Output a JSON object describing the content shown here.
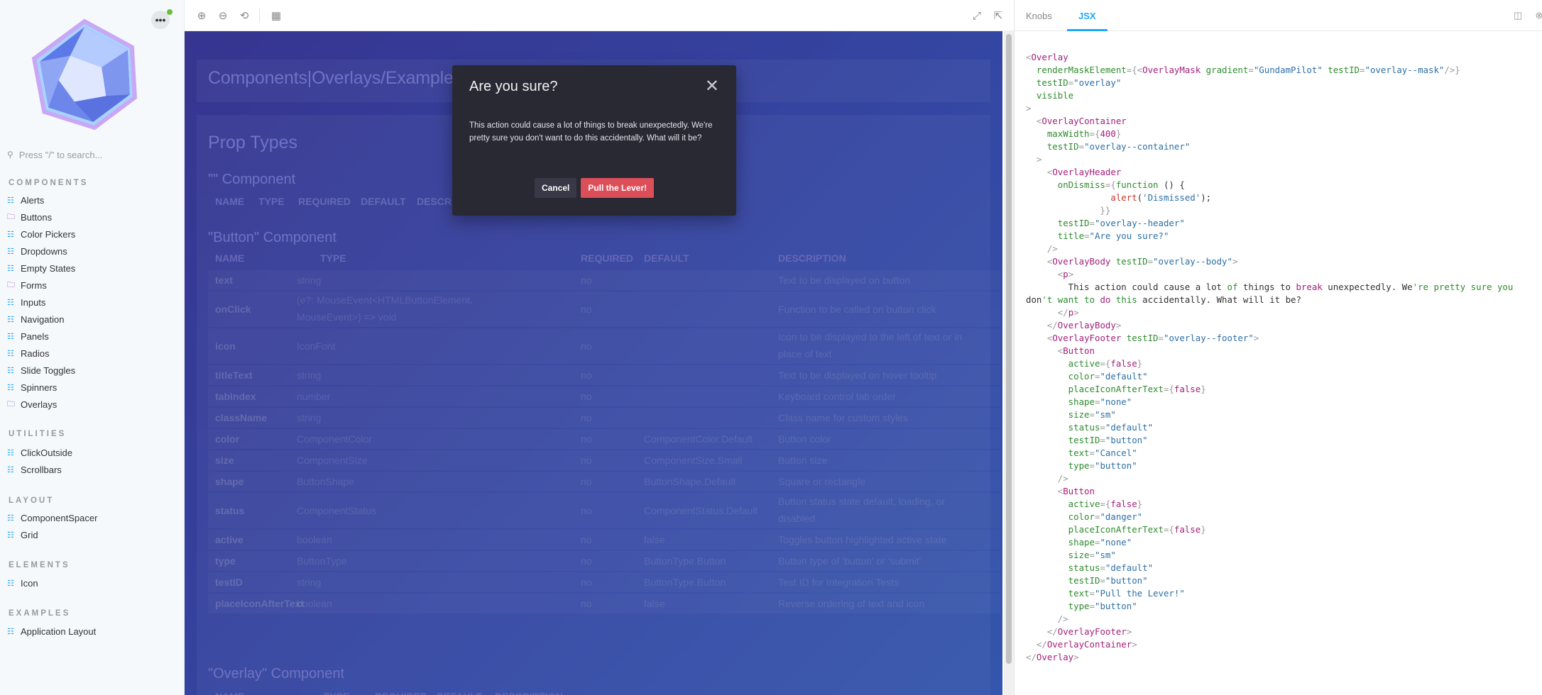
{
  "sidebar": {
    "search_placeholder": "Press \"/\" to search...",
    "sections": [
      {
        "heading": "COMPONENTS",
        "items": [
          "Alerts",
          "Buttons",
          "Color Pickers",
          "Dropdowns",
          "Empty States",
          "Forms",
          "Inputs",
          "Navigation",
          "Panels",
          "Radios",
          "Slide Toggles",
          "Spinners",
          "Overlays"
        ]
      },
      {
        "heading": "UTILITIES",
        "items": [
          "ClickOutside",
          "Scrollbars"
        ]
      },
      {
        "heading": "LAYOUT",
        "items": [
          "ComponentSpacer",
          "Grid"
        ]
      },
      {
        "heading": "ELEMENTS",
        "items": [
          "Icon"
        ]
      },
      {
        "heading": "EXAMPLES",
        "items": [
          "Application Layout"
        ]
      }
    ]
  },
  "preview": {
    "story_title": "Components|Overlays/Examples",
    "prop_types_heading": "Prop Types",
    "empty_component_title": "\"\" Component",
    "empty_component_headers": [
      "NAME",
      "TYPE",
      "REQUIRED",
      "DEFAULT",
      "DESCRI"
    ],
    "button_component_title": "\"Button\" Component",
    "headers": [
      "NAME",
      "TYPE",
      "REQUIRED",
      "DEFAULT",
      "DESCRIPTION"
    ],
    "rows": [
      {
        "name": "text",
        "type": "string",
        "required": "no",
        "default": "",
        "description": "Text to be displayed on button"
      },
      {
        "name": "onClick",
        "type": "(e?: MouseEvent<HTMLButtonElement,",
        "type2": "MouseEvent>) => void",
        "required": "no",
        "default": "",
        "description": "Function to be called on button click"
      },
      {
        "name": "icon",
        "type": "IconFont",
        "required": "no",
        "default": "",
        "description": "Icon to be displayed to the left of text or in",
        "description2": "place of text"
      },
      {
        "name": "titleText",
        "type": "string",
        "required": "no",
        "default": "",
        "description": "Text to be displayed on hover tooltip"
      },
      {
        "name": "tabIndex",
        "type": "number",
        "required": "no",
        "default": "",
        "description": "Keyboard control tab order"
      },
      {
        "name": "className",
        "type": "string",
        "required": "no",
        "default": "",
        "description": "Class name for custom styles"
      },
      {
        "name": "color",
        "type": "ComponentColor",
        "required": "no",
        "default": "ComponentColor.Default",
        "description": "Button color"
      },
      {
        "name": "size",
        "type": "ComponentSize",
        "required": "no",
        "default": "ComponentSize.Small",
        "description": "Button size"
      },
      {
        "name": "shape",
        "type": "ButtonShape",
        "required": "no",
        "default": "ButtonShape.Default",
        "description": "Square or rectangle"
      },
      {
        "name": "status",
        "type": "ComponentStatus",
        "required": "no",
        "default": "ComponentStatus.Default",
        "description": "Button status state default, loading, or",
        "description2": "disabled"
      },
      {
        "name": "active",
        "type": "boolean",
        "required": "no",
        "default": "false",
        "description": "Toggles button highlighted active state"
      },
      {
        "name": "type",
        "type": "ButtonType",
        "required": "no",
        "default": "ButtonType.Button",
        "description": "Button type of 'button' or 'submit'"
      },
      {
        "name": "testID",
        "type": "string",
        "required": "no",
        "default": "ButtonType.Button",
        "description": "Test ID for Integration Tests"
      },
      {
        "name": "placeIconAfterText",
        "type": "boolean",
        "required": "no",
        "default": "false",
        "description": "Reverse ordering of text and icon"
      }
    ],
    "overlay_component_title": "\"Overlay\" Component"
  },
  "dialog": {
    "title": "Are you sure?",
    "body": "This action could cause a lot of things to break unexpectedly. We're pretty sure you don't want to do this accidentally. What will it be?",
    "cancel_label": "Cancel",
    "confirm_label": "Pull the Lever!"
  },
  "addons": {
    "tabs": [
      "Knobs",
      "JSX"
    ],
    "active_tab": "JSX"
  },
  "code_lines": [
    [
      {
        "t": "<",
        "c": "pn"
      },
      {
        "t": "Overlay",
        "c": "tg"
      }
    ],
    [
      {
        "t": "  renderMaskElement",
        "c": "at"
      },
      {
        "t": "={<",
        "c": "pn"
      },
      {
        "t": "OverlayMask",
        "c": "tg"
      },
      {
        "t": " gradient",
        "c": "at"
      },
      {
        "t": "=",
        "c": "pn"
      },
      {
        "t": "\"GundamPilot\"",
        "c": "st"
      },
      {
        "t": " testID",
        "c": "at"
      },
      {
        "t": "=",
        "c": "pn"
      },
      {
        "t": "\"overlay--mask\"",
        "c": "st"
      },
      {
        "t": "/>}",
        "c": "pn"
      }
    ],
    [
      {
        "t": "  testID",
        "c": "at"
      },
      {
        "t": "=",
        "c": "pn"
      },
      {
        "t": "\"overlay\"",
        "c": "st"
      }
    ],
    [
      {
        "t": "  visible",
        "c": "at"
      }
    ],
    [
      {
        "t": ">",
        "c": "pn"
      }
    ],
    [
      {
        "t": "  <",
        "c": "pn"
      },
      {
        "t": "OverlayContainer",
        "c": "tg"
      }
    ],
    [
      {
        "t": "    maxWidth",
        "c": "at"
      },
      {
        "t": "={",
        "c": "pn"
      },
      {
        "t": "400",
        "c": "bo"
      },
      {
        "t": "}",
        "c": "pn"
      }
    ],
    [
      {
        "t": "    testID",
        "c": "at"
      },
      {
        "t": "=",
        "c": "pn"
      },
      {
        "t": "\"overlay--container\"",
        "c": "st"
      }
    ],
    [
      {
        "t": "  >",
        "c": "pn"
      }
    ],
    [
      {
        "t": "    <",
        "c": "pn"
      },
      {
        "t": "OverlayHeader",
        "c": "tg"
      }
    ],
    [
      {
        "t": "      onDismiss",
        "c": "at"
      },
      {
        "t": "={",
        "c": "pn"
      },
      {
        "t": "function",
        "c": "kw"
      },
      {
        "t": " () {",
        "c": "tx"
      }
    ],
    [
      {
        "t": "                ",
        "c": "tx"
      },
      {
        "t": "alert",
        "c": "fn"
      },
      {
        "t": "(",
        "c": "tx"
      },
      {
        "t": "'Dismissed'",
        "c": "st"
      },
      {
        "t": ");",
        "c": "tx"
      }
    ],
    [
      {
        "t": "              }}",
        "c": "pn"
      }
    ],
    [
      {
        "t": "      testID",
        "c": "at"
      },
      {
        "t": "=",
        "c": "pn"
      },
      {
        "t": "\"overlay--header\"",
        "c": "st"
      }
    ],
    [
      {
        "t": "      title",
        "c": "at"
      },
      {
        "t": "=",
        "c": "pn"
      },
      {
        "t": "\"Are you sure?\"",
        "c": "st"
      }
    ],
    [
      {
        "t": "    />",
        "c": "pn"
      }
    ],
    [
      {
        "t": "    <",
        "c": "pn"
      },
      {
        "t": "OverlayBody",
        "c": "tg"
      },
      {
        "t": " testID",
        "c": "at"
      },
      {
        "t": "=",
        "c": "pn"
      },
      {
        "t": "\"overlay--body\"",
        "c": "st"
      },
      {
        "t": ">",
        "c": "pn"
      }
    ],
    [
      {
        "t": "      <",
        "c": "pn"
      },
      {
        "t": "p",
        "c": "tg"
      },
      {
        "t": ">",
        "c": "pn"
      }
    ],
    [
      {
        "t": "        This action could cause a lot ",
        "c": "tx"
      },
      {
        "t": "of",
        "c": "kw"
      },
      {
        "t": " things to ",
        "c": "tx"
      },
      {
        "t": "break",
        "c": "tg"
      },
      {
        "t": " unexpectedly. We",
        "c": "tx"
      },
      {
        "t": "'re pretty sure you",
        "c": "kw"
      }
    ],
    [
      {
        "t": "don",
        "c": "tx"
      },
      {
        "t": "'t want to",
        "c": "kw"
      },
      {
        "t": " ",
        "c": "tx"
      },
      {
        "t": "do",
        "c": "tg"
      },
      {
        "t": " ",
        "c": "tx"
      },
      {
        "t": "this",
        "c": "kw"
      },
      {
        "t": " accidentally. What will it be?",
        "c": "tx"
      }
    ],
    [
      {
        "t": "      </",
        "c": "pn"
      },
      {
        "t": "p",
        "c": "tg"
      },
      {
        "t": ">",
        "c": "pn"
      }
    ],
    [
      {
        "t": "    </",
        "c": "pn"
      },
      {
        "t": "OverlayBody",
        "c": "tg"
      },
      {
        "t": ">",
        "c": "pn"
      }
    ],
    [
      {
        "t": "    <",
        "c": "pn"
      },
      {
        "t": "OverlayFooter",
        "c": "tg"
      },
      {
        "t": " testID",
        "c": "at"
      },
      {
        "t": "=",
        "c": "pn"
      },
      {
        "t": "\"overlay--footer\"",
        "c": "st"
      },
      {
        "t": ">",
        "c": "pn"
      }
    ],
    [
      {
        "t": "      <",
        "c": "pn"
      },
      {
        "t": "Button",
        "c": "tg"
      }
    ],
    [
      {
        "t": "        active",
        "c": "at"
      },
      {
        "t": "={",
        "c": "pn"
      },
      {
        "t": "false",
        "c": "bo"
      },
      {
        "t": "}",
        "c": "pn"
      }
    ],
    [
      {
        "t": "        color",
        "c": "at"
      },
      {
        "t": "=",
        "c": "pn"
      },
      {
        "t": "\"default\"",
        "c": "st"
      }
    ],
    [
      {
        "t": "        placeIconAfterText",
        "c": "at"
      },
      {
        "t": "={",
        "c": "pn"
      },
      {
        "t": "false",
        "c": "bo"
      },
      {
        "t": "}",
        "c": "pn"
      }
    ],
    [
      {
        "t": "        shape",
        "c": "at"
      },
      {
        "t": "=",
        "c": "pn"
      },
      {
        "t": "\"none\"",
        "c": "st"
      }
    ],
    [
      {
        "t": "        size",
        "c": "at"
      },
      {
        "t": "=",
        "c": "pn"
      },
      {
        "t": "\"sm\"",
        "c": "st"
      }
    ],
    [
      {
        "t": "        status",
        "c": "at"
      },
      {
        "t": "=",
        "c": "pn"
      },
      {
        "t": "\"default\"",
        "c": "st"
      }
    ],
    [
      {
        "t": "        testID",
        "c": "at"
      },
      {
        "t": "=",
        "c": "pn"
      },
      {
        "t": "\"button\"",
        "c": "st"
      }
    ],
    [
      {
        "t": "        text",
        "c": "at"
      },
      {
        "t": "=",
        "c": "pn"
      },
      {
        "t": "\"Cancel\"",
        "c": "st"
      }
    ],
    [
      {
        "t": "        type",
        "c": "at"
      },
      {
        "t": "=",
        "c": "pn"
      },
      {
        "t": "\"button\"",
        "c": "st"
      }
    ],
    [
      {
        "t": "      />",
        "c": "pn"
      }
    ],
    [
      {
        "t": "      <",
        "c": "pn"
      },
      {
        "t": "Button",
        "c": "tg"
      }
    ],
    [
      {
        "t": "        active",
        "c": "at"
      },
      {
        "t": "={",
        "c": "pn"
      },
      {
        "t": "false",
        "c": "bo"
      },
      {
        "t": "}",
        "c": "pn"
      }
    ],
    [
      {
        "t": "        color",
        "c": "at"
      },
      {
        "t": "=",
        "c": "pn"
      },
      {
        "t": "\"danger\"",
        "c": "st"
      }
    ],
    [
      {
        "t": "        placeIconAfterText",
        "c": "at"
      },
      {
        "t": "={",
        "c": "pn"
      },
      {
        "t": "false",
        "c": "bo"
      },
      {
        "t": "}",
        "c": "pn"
      }
    ],
    [
      {
        "t": "        shape",
        "c": "at"
      },
      {
        "t": "=",
        "c": "pn"
      },
      {
        "t": "\"none\"",
        "c": "st"
      }
    ],
    [
      {
        "t": "        size",
        "c": "at"
      },
      {
        "t": "=",
        "c": "pn"
      },
      {
        "t": "\"sm\"",
        "c": "st"
      }
    ],
    [
      {
        "t": "        status",
        "c": "at"
      },
      {
        "t": "=",
        "c": "pn"
      },
      {
        "t": "\"default\"",
        "c": "st"
      }
    ],
    [
      {
        "t": "        testID",
        "c": "at"
      },
      {
        "t": "=",
        "c": "pn"
      },
      {
        "t": "\"button\"",
        "c": "st"
      }
    ],
    [
      {
        "t": "        text",
        "c": "at"
      },
      {
        "t": "=",
        "c": "pn"
      },
      {
        "t": "\"Pull the Lever!\"",
        "c": "st"
      }
    ],
    [
      {
        "t": "        type",
        "c": "at"
      },
      {
        "t": "=",
        "c": "pn"
      },
      {
        "t": "\"button\"",
        "c": "st"
      }
    ],
    [
      {
        "t": "      />",
        "c": "pn"
      }
    ],
    [
      {
        "t": "    </",
        "c": "pn"
      },
      {
        "t": "OverlayFooter",
        "c": "tg"
      },
      {
        "t": ">",
        "c": "pn"
      }
    ],
    [
      {
        "t": "  </",
        "c": "pn"
      },
      {
        "t": "OverlayContainer",
        "c": "tg"
      },
      {
        "t": ">",
        "c": "pn"
      }
    ],
    [
      {
        "t": "</",
        "c": "pn"
      },
      {
        "t": "Overlay",
        "c": "tg"
      },
      {
        "t": ">",
        "c": "pn"
      }
    ]
  ]
}
